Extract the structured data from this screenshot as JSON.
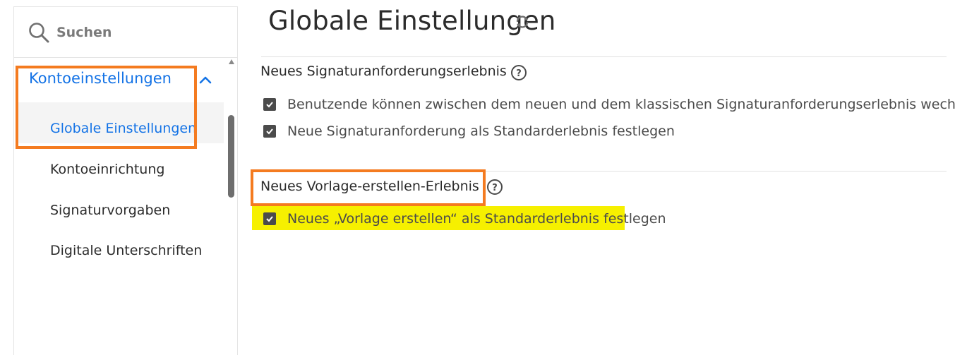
{
  "search": {
    "placeholder": "Suchen"
  },
  "sidebar": {
    "section_label": "Kontoeinstellungen",
    "items": [
      {
        "label": "Globale Einstellungen",
        "active": true
      },
      {
        "label": "Kontoeinrichtung",
        "active": false
      },
      {
        "label": "Signaturvorgaben",
        "active": false
      },
      {
        "label": "Digitale Unterschriften",
        "active": false
      }
    ]
  },
  "main": {
    "title": "Globale Einstellungen",
    "sections": [
      {
        "title": "Neues Signaturanforderungserlebnis",
        "options": [
          {
            "label": "Benutzende können zwischen dem neuen und dem klassischen Signaturanforderungserlebnis wechseln",
            "checked": true
          },
          {
            "label": "Neue Signaturanforderung als Standarderlebnis festlegen",
            "checked": true
          }
        ]
      },
      {
        "title": "Neues Vorlage-erstellen-Erlebnis",
        "options": [
          {
            "label": "Neues „Vorlage erstellen“ als Standarderlebnis festlegen",
            "checked": true
          }
        ]
      }
    ]
  },
  "colors": {
    "accent": "#1473e6",
    "annotation_box": "#f47b20",
    "annotation_highlight": "#f6f000"
  },
  "icons": [
    "search-icon",
    "chevron-up-icon",
    "refresh-icon",
    "help-icon",
    "check-icon"
  ]
}
